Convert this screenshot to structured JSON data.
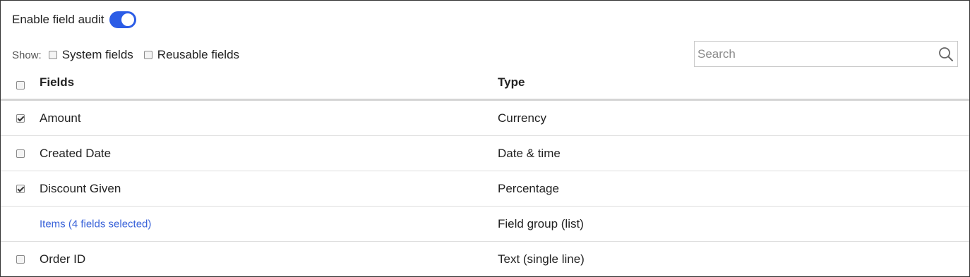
{
  "audit": {
    "label": "Enable field audit",
    "enabled": true
  },
  "show": {
    "label": "Show:",
    "options": [
      {
        "label": "System fields",
        "checked": false
      },
      {
        "label": "Reusable fields",
        "checked": false
      }
    ]
  },
  "search": {
    "placeholder": "Search",
    "value": ""
  },
  "table": {
    "headers": {
      "fields": "Fields",
      "type": "Type"
    },
    "rows": [
      {
        "field": "Amount",
        "type": "Currency",
        "checked": true,
        "has_checkbox": true,
        "is_link": false
      },
      {
        "field": "Created Date",
        "type": "Date & time",
        "checked": false,
        "has_checkbox": true,
        "is_link": false
      },
      {
        "field": "Discount Given",
        "type": "Percentage",
        "checked": true,
        "has_checkbox": true,
        "is_link": false
      },
      {
        "field": "Items (4 fields selected)",
        "type": "Field group (list)",
        "checked": false,
        "has_checkbox": false,
        "is_link": true
      },
      {
        "field": "Order ID",
        "type": "Text (single line)",
        "checked": false,
        "has_checkbox": true,
        "is_link": false
      }
    ]
  },
  "colors": {
    "accent": "#2b5ce6",
    "link": "#3a63d9"
  }
}
